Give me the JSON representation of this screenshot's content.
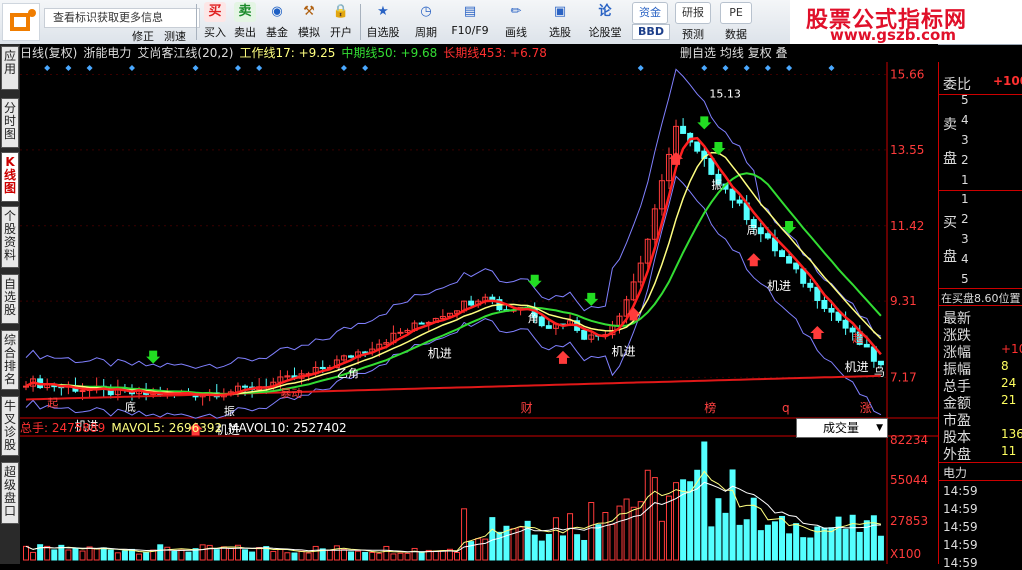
{
  "toolbar": {
    "hint": "查看标识获取更多信息",
    "buttons": [
      {
        "label": "修正",
        "glyph": "✎"
      },
      {
        "label": "测速",
        "glyph": "⌚"
      },
      {
        "label": "买入",
        "glyph": "买",
        "color": "#e02020"
      },
      {
        "label": "卖出",
        "glyph": "卖",
        "color": "#1a8a2a"
      },
      {
        "label": "基金",
        "glyph": "◉",
        "color": "#1d5fc4"
      },
      {
        "label": "模拟",
        "glyph": "⚒",
        "color": "#b06010"
      },
      {
        "label": "开户",
        "glyph": "🔒",
        "color": "#666"
      },
      {
        "label": "自选股",
        "glyph": "★",
        "color": "#2a63c4"
      },
      {
        "label": "周期",
        "glyph": "◷",
        "color": "#2a63c4"
      },
      {
        "label": "F10/F9",
        "glyph": "▤",
        "color": "#2a63c4"
      },
      {
        "label": "画线",
        "glyph": "✏",
        "color": "#2a63c4"
      },
      {
        "label": "选股",
        "glyph": "▣",
        "color": "#2a63c4"
      },
      {
        "label": "论股堂",
        "glyph": "论",
        "color": "#2a63c4"
      },
      {
        "label": "资讯",
        "glyph": "资金",
        "color": "#2a63c4"
      },
      {
        "label": "预测",
        "glyph": "研报",
        "color": "#333"
      },
      {
        "label": "数据",
        "glyph": "PE",
        "color": "#333"
      }
    ],
    "extra": [
      "BBD",
      "预测"
    ]
  },
  "brand": {
    "title": "股票公式指标网",
    "url": "www.gszb.com"
  },
  "left_tabs": [
    "应用",
    "分时图",
    "K线图",
    "个股资料",
    "自选股",
    "综合排名",
    "牛叉诊股",
    "超级盘口"
  ],
  "chart_header": {
    "period": "日线(复权)",
    "stock": "浙能电力",
    "indicator": "艾尚客江线(20,2)",
    "work_line": "工作线17: +9.25",
    "mid_line": "中期线50: +9.68",
    "long_line": "长期线453: +6.78",
    "right_items": [
      "删自选",
      "均线",
      "复权",
      "叠"
    ]
  },
  "price_axis": [
    "15.66",
    "13.55",
    "11.42",
    "9.31",
    "7.17"
  ],
  "volume_axis": [
    "82234",
    "55044",
    "27853",
    "X100"
  ],
  "volume_header": {
    "total": "总手: 2475889",
    "mavol5": "MAVOL5: 2696392",
    "mavol10": "MAVOL10: 2527402",
    "select": "成交量"
  },
  "chart_labels": {
    "peak": "15.13",
    "signals": [
      "机进",
      "机进",
      "机进",
      "机进",
      "机进",
      "机进"
    ],
    "markers": [
      "财",
      "榜",
      "q",
      "涨"
    ],
    "notes": [
      "起",
      "底",
      "振",
      "暴动",
      "乙角",
      "角",
      "振",
      "局",
      "乌",
      "超"
    ]
  },
  "right_panel": {
    "weibi_label": "委比",
    "weibi_value": "+100",
    "sell_label": [
      "卖",
      "盘"
    ],
    "sell_levels": [
      "5",
      "4",
      "3",
      "2",
      "1"
    ],
    "buy_label": [
      "买",
      "盘"
    ],
    "buy_levels": [
      "1",
      "2",
      "3",
      "4",
      "5"
    ],
    "status": "在买盘8.60位置",
    "stats": [
      {
        "k": "最新",
        "v": ""
      },
      {
        "k": "涨跌",
        "v": ""
      },
      {
        "k": "涨幅",
        "v": "+10"
      },
      {
        "k": "振幅",
        "v": "8"
      },
      {
        "k": "总手",
        "v": "24"
      },
      {
        "k": "金额",
        "v": "21"
      },
      {
        "k": "市盈",
        "v": ""
      },
      {
        "k": "股本",
        "v": "136"
      },
      {
        "k": "外盘",
        "v": "11"
      }
    ],
    "section": "电力",
    "ticks": [
      "14:59",
      "14:59",
      "14:59",
      "14:59",
      "14:59"
    ]
  },
  "colors": {
    "up": "#ff3b3b",
    "down": "#54ffff",
    "work": "#ffff80",
    "mid": "#33dd33",
    "long": "#e01818",
    "axis": "#e01818"
  }
}
